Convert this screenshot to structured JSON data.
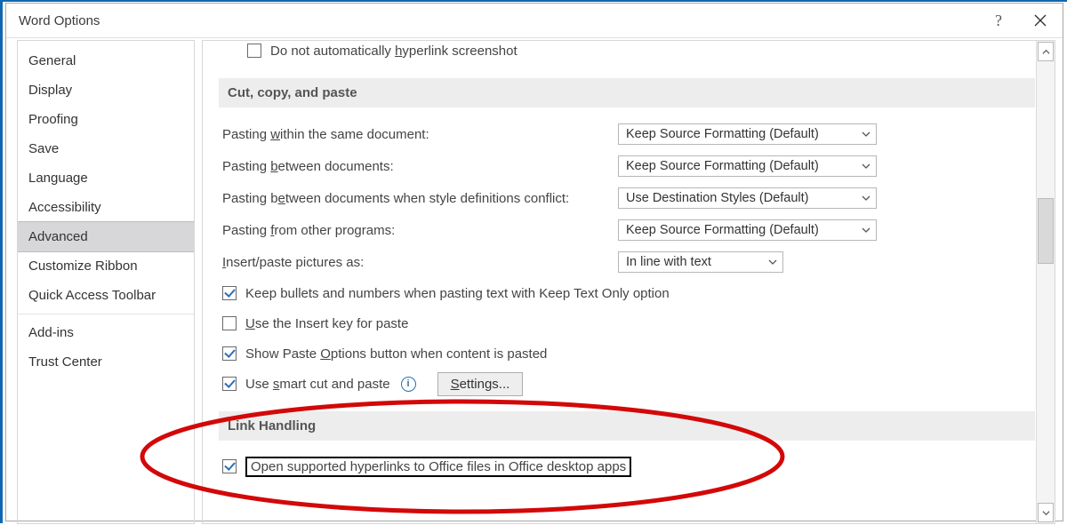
{
  "window": {
    "title": "Word Options"
  },
  "nav": {
    "items": [
      {
        "label": "General"
      },
      {
        "label": "Display"
      },
      {
        "label": "Proofing"
      },
      {
        "label": "Save"
      },
      {
        "label": "Language"
      },
      {
        "label": "Accessibility"
      },
      {
        "label": "Advanced",
        "selected": true
      },
      {
        "label": "Customize Ribbon"
      },
      {
        "label": "Quick Access Toolbar"
      }
    ],
    "items2": [
      {
        "label": "Add-ins"
      },
      {
        "label": "Trust Center"
      }
    ]
  },
  "pane": {
    "top_checkbox": {
      "checked": false,
      "label_pre": "Do not automatically ",
      "label_ul": "h",
      "label_post": "yperlink screenshot"
    },
    "ccp_header": "Cut, copy, and paste",
    "rows": {
      "r1": {
        "pre": "Pasting ",
        "ul": "w",
        "post": "ithin the same document:",
        "value": "Keep Source Formatting (Default)"
      },
      "r2": {
        "pre": "Pasting ",
        "ul": "b",
        "post": "etween documents:",
        "value": "Keep Source Formatting (Default)"
      },
      "r3": {
        "pre": "Pasting b",
        "ul": "e",
        "post": "tween documents when style definitions conflict:",
        "value": "Use Destination Styles (Default)"
      },
      "r4": {
        "pre": "Pasting ",
        "ul": "f",
        "post": "rom other programs:",
        "value": "Keep Source Formatting (Default)"
      },
      "r5": {
        "pre": "",
        "ul": "I",
        "post": "nsert/paste pictures as:",
        "value": "In line with text"
      }
    },
    "chk1": {
      "checked": true,
      "text": "Keep bullets and numbers when pasting text with Keep Text Only option"
    },
    "chk2": {
      "checked": false,
      "ul": "U",
      "post": "se the Insert key for paste"
    },
    "chk3": {
      "checked": true,
      "pre": "Show Paste ",
      "ul": "O",
      "post": "ptions button when content is pasted"
    },
    "chk4": {
      "checked": true,
      "pre": "Use ",
      "ul": "s",
      "post": "mart cut and paste"
    },
    "settings_btn": "Settings...",
    "lh_header": "Link Handling",
    "lh_chk": {
      "checked": true,
      "text": "Open supported hyperlinks to Office files in Office desktop apps"
    }
  }
}
